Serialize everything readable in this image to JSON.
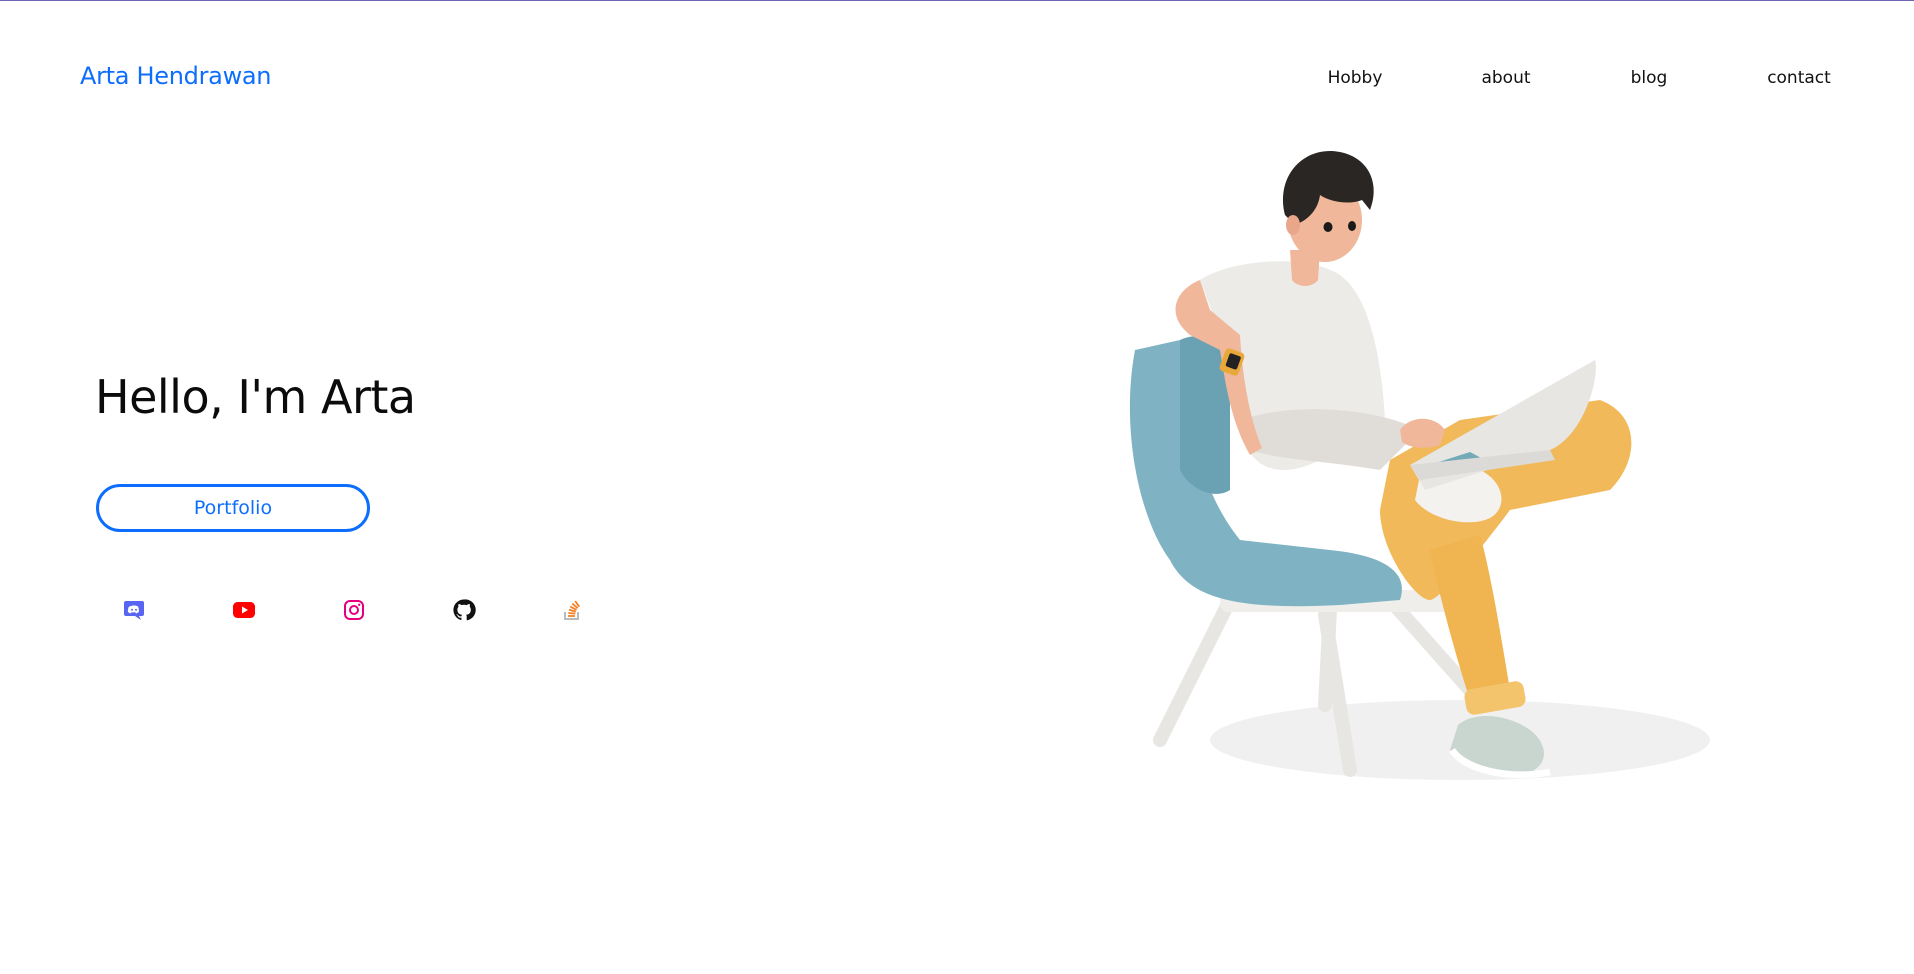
{
  "header": {
    "brand": "Arta Hendrawan",
    "nav": [
      {
        "label": "Hobby"
      },
      {
        "label": "about"
      },
      {
        "label": "blog"
      },
      {
        "label": "contact"
      }
    ]
  },
  "hero": {
    "greeting": "Hello, I'm Arta",
    "button_label": "Portfolio"
  },
  "social": [
    {
      "icon": "discord-icon",
      "color": "#5865f2"
    },
    {
      "icon": "youtube-icon",
      "color": "#ff0000"
    },
    {
      "icon": "instagram-icon",
      "color": "#e4007c"
    },
    {
      "icon": "github-icon",
      "color": "#111111"
    },
    {
      "icon": "stackoverflow-icon",
      "color": "#f48024"
    }
  ],
  "colors": {
    "accent": "#0d6efd",
    "text": "#0b0b0b",
    "chair": "#7fb3c4",
    "shirt": "#ecebe8",
    "pants": "#f1b95a",
    "hair": "#2a2624",
    "skin": "#f0b79a"
  },
  "illustration": {
    "icon": "person-on-chair-with-laptop-illustration"
  }
}
